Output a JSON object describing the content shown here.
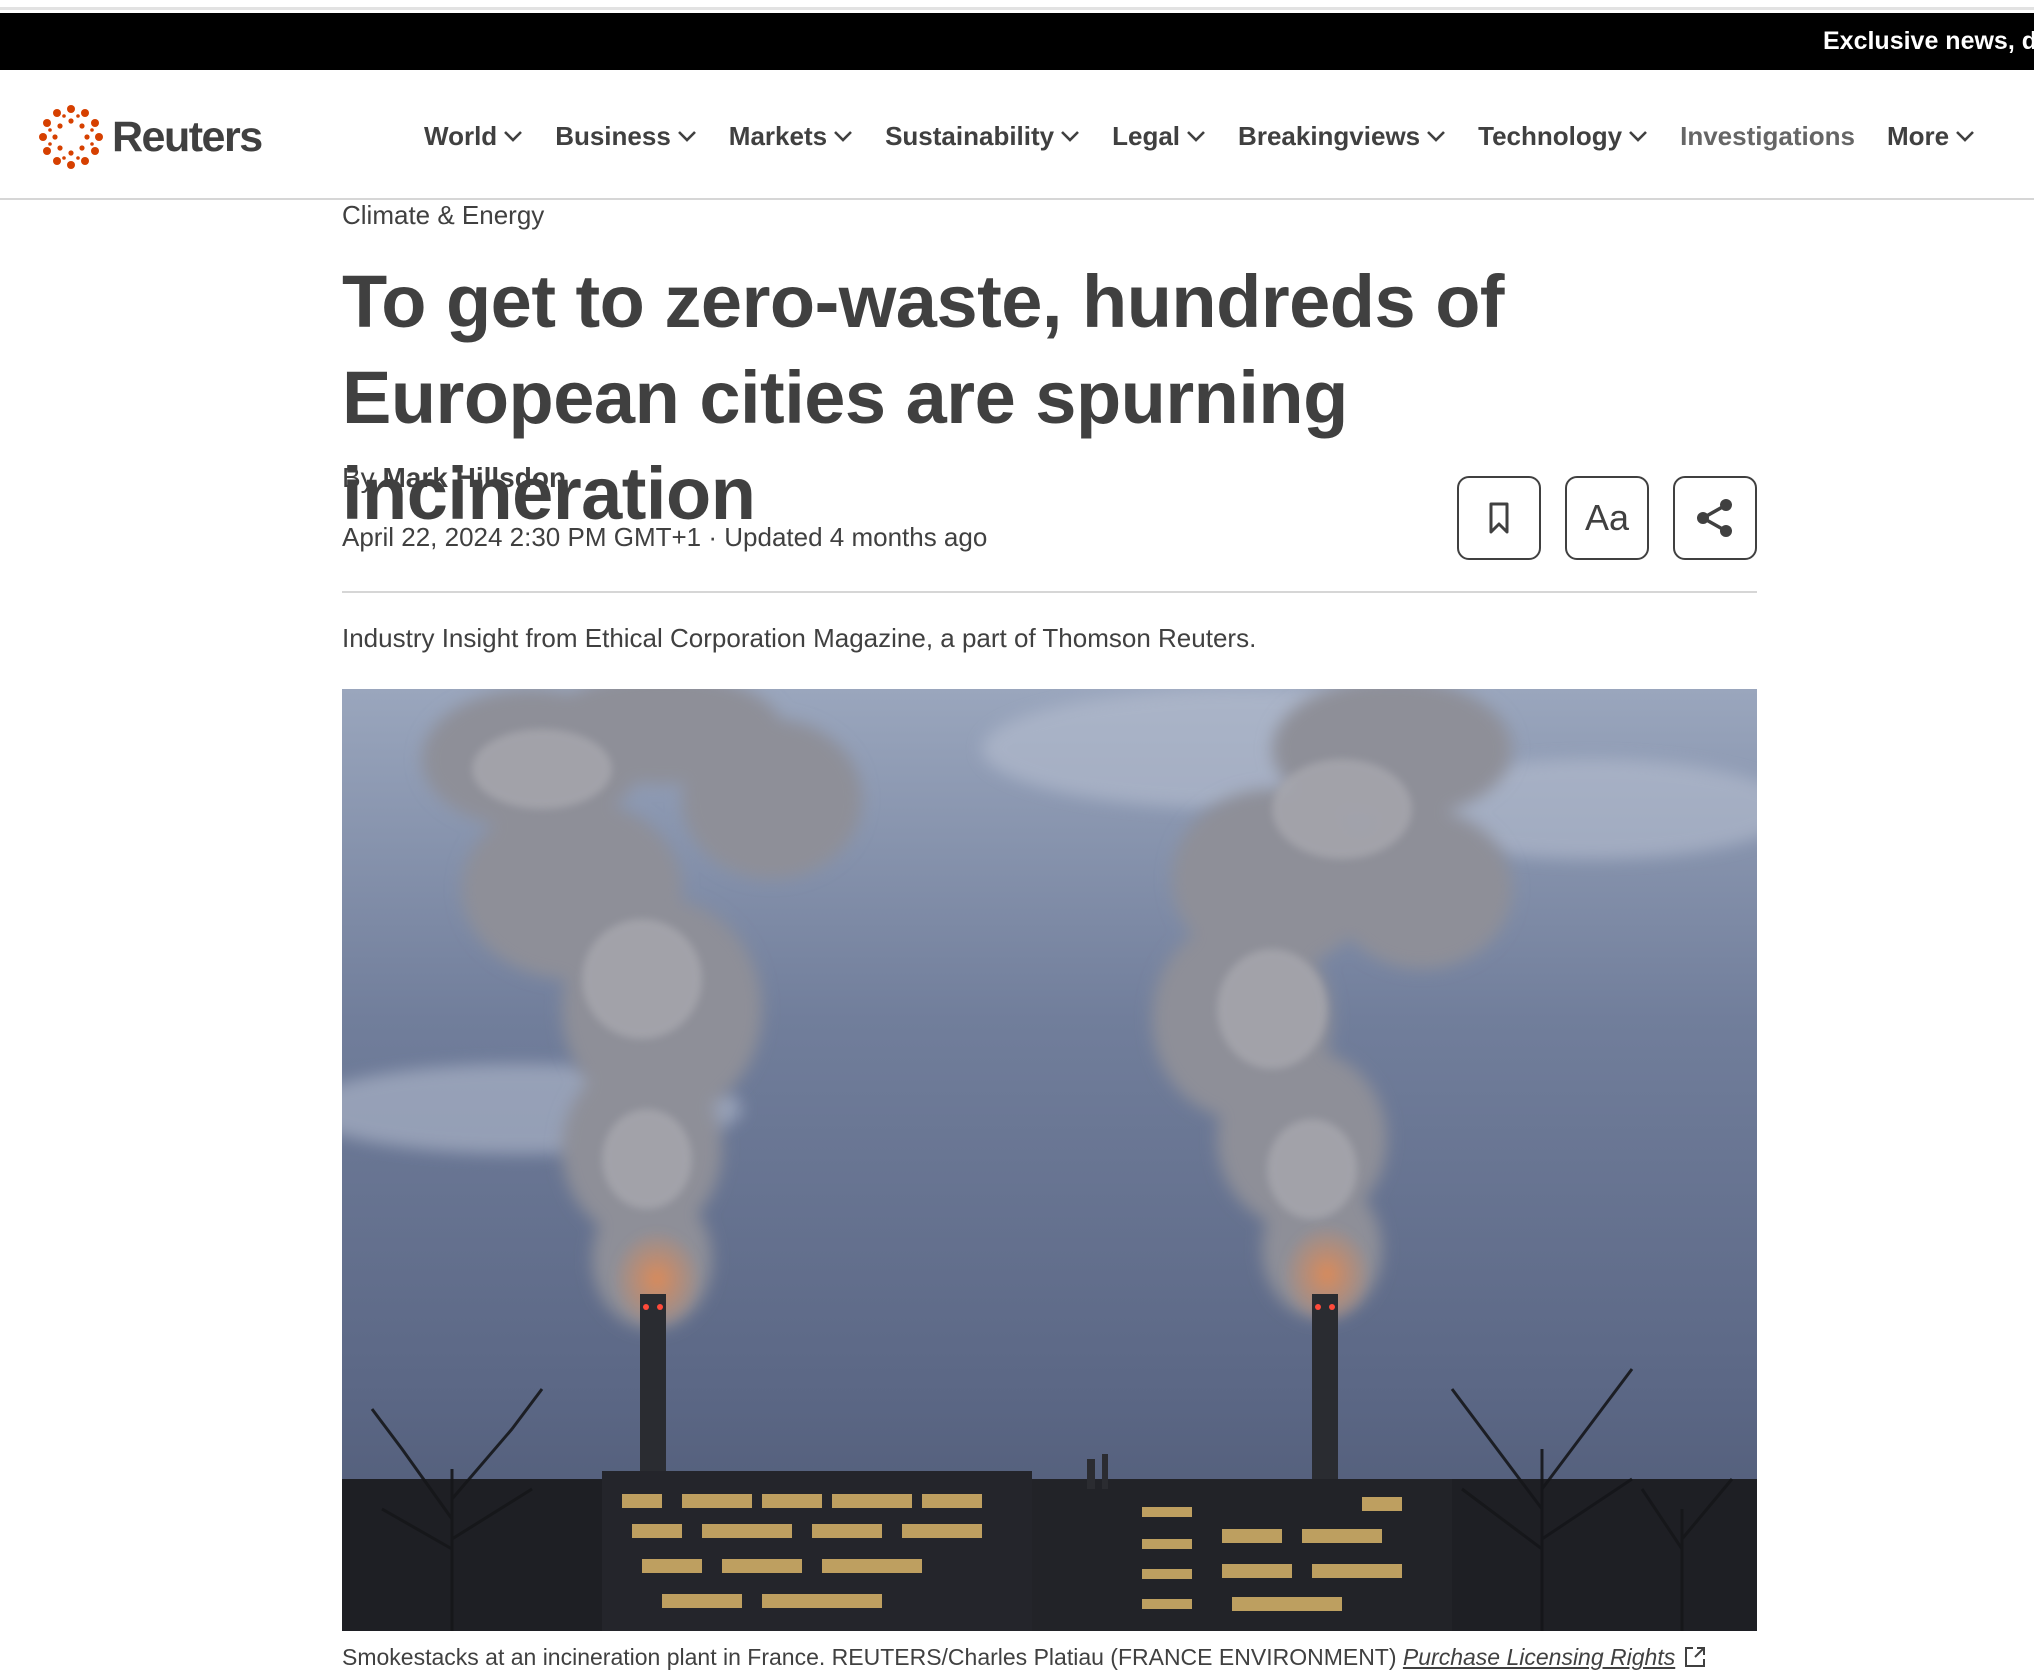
{
  "promo": {
    "text": "Exclusive news, d"
  },
  "header": {
    "logo_text": "Reuters",
    "brand_color": "#d64000",
    "nav": [
      {
        "label": "World",
        "dropdown": true
      },
      {
        "label": "Business",
        "dropdown": true
      },
      {
        "label": "Markets",
        "dropdown": true
      },
      {
        "label": "Sustainability",
        "dropdown": true
      },
      {
        "label": "Legal",
        "dropdown": true
      },
      {
        "label": "Breakingviews",
        "dropdown": true
      },
      {
        "label": "Technology",
        "dropdown": true
      },
      {
        "label": "Investigations",
        "dropdown": false
      },
      {
        "label": "More",
        "dropdown": true
      }
    ]
  },
  "article": {
    "kicker": "Climate & Energy",
    "headline": "To get to zero-waste, hundreds of European cities are spurning incineration",
    "byline_prefix": "By",
    "author": "Mark Hillsdon",
    "date": "April 22, 2024 2:30 PM GMT+1",
    "updated": "· Updated 4 months ago",
    "tools": {
      "bookmark": "bookmark-icon",
      "text_size": "Aa",
      "share": "share-icon"
    },
    "insight": "Industry Insight from Ethical Corporation Magazine, a part of Thomson Reuters.",
    "image_caption": "Smokestacks at an incineration plant in France. REUTERS/Charles Platiau (FRANCE ENVIRONMENT)",
    "licensing_link": "Purchase Licensing Rights"
  }
}
